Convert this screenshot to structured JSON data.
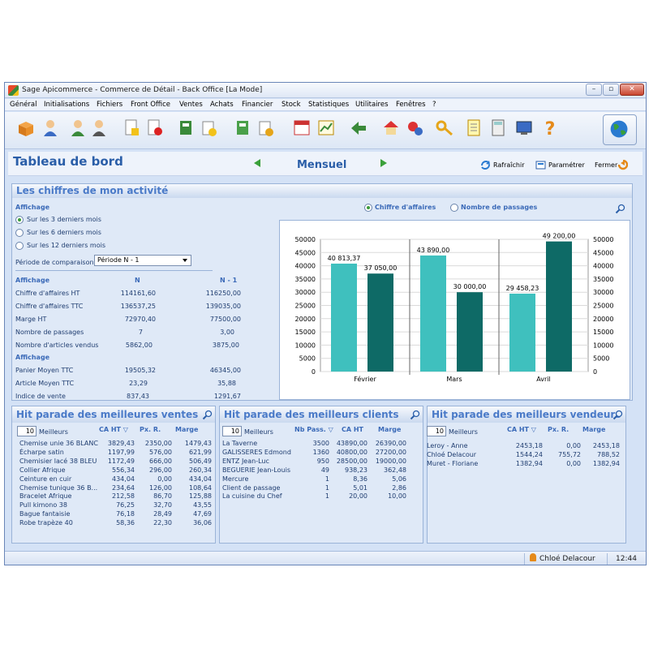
{
  "window": {
    "title": "Sage Apicommerce - Commerce de Détail - Back Office [La Mode]",
    "min_glyph": "–",
    "max_glyph": "▫",
    "close_glyph": "✕"
  },
  "menu": [
    "Général",
    "Initialisations",
    "Fichiers",
    "Front Office",
    "Ventes",
    "Achats",
    "Financier",
    "Stock",
    "Statistiques",
    "Utilitaires",
    "Fenêtres",
    "?"
  ],
  "header": {
    "title": "Tableau de bord",
    "period": "Mensuel",
    "refresh_label": "Rafraîchir",
    "settings_label": "Paramétrer",
    "close_label": "Fermer"
  },
  "activity": {
    "title": "Les chiffres de mon activité",
    "display_label": "Affichage",
    "options": [
      "Sur les 3 derniers mois",
      "Sur les 6 derniers mois",
      "Sur les 12 derniers mois"
    ],
    "comparison_label": "Période de comparaison",
    "comparison_value": "Période N - 1",
    "col_n": "N",
    "col_n1": "N - 1",
    "section1": "Affichage",
    "rows1": [
      {
        "label": "Chiffre d'affaires HT",
        "n": "114161,60",
        "n1": "116250,00"
      },
      {
        "label": "Chiffre d'affaires TTC",
        "n": "136537,25",
        "n1": "139035,00"
      },
      {
        "label": "Marge HT",
        "n": "72970,40",
        "n1": "77500,00"
      },
      {
        "label": "Nombre de passages",
        "n": "7",
        "n1": "3,00"
      },
      {
        "label": "Nombre d'articles vendus",
        "n": "5862,00",
        "n1": "3875,00"
      }
    ],
    "section2": "Affichage",
    "rows2": [
      {
        "label": "Panier Moyen TTC",
        "n": "19505,32",
        "n1": "46345,00"
      },
      {
        "label": "Article Moyen TTC",
        "n": "23,29",
        "n1": "35,88"
      },
      {
        "label": "Indice de vente",
        "n": "837,43",
        "n1": "1291,67"
      }
    ],
    "chart_opt1": "Chiffre d'affaires",
    "chart_opt2": "Nombre de passages"
  },
  "chart_data": {
    "type": "bar",
    "categories": [
      "Février",
      "Mars",
      "Avril"
    ],
    "series": [
      {
        "values": [
          40813.37,
          43890.0,
          29458.23
        ],
        "labels": [
          "40 813,37",
          "43 890,00",
          "29 458,23"
        ],
        "color": "#3fc0be"
      },
      {
        "values": [
          37050.0,
          30000.0,
          49200.0
        ],
        "labels": [
          "37 050,00",
          "30 000,00",
          "49 200,00"
        ],
        "color": "#0e6a66"
      }
    ],
    "ylim": [
      0,
      50000
    ],
    "yticks": [
      "0",
      "5000",
      "10000",
      "15000",
      "20000",
      "25000",
      "30000",
      "35000",
      "40000",
      "45000",
      "50000"
    ],
    "grid": true,
    "dual_axis": true
  },
  "hit_sales": {
    "title": "Hit parade des meilleures ventes",
    "count": "10",
    "count_label": "Meilleurs",
    "cols": [
      "CA HT ▽",
      "Px. R.",
      "Marge"
    ],
    "rows": [
      [
        "Chemise unie 36 BLANC",
        "3829,43",
        "2350,00",
        "1479,43"
      ],
      [
        "Écharpe satin",
        "1197,99",
        "576,00",
        "621,99"
      ],
      [
        "Chemisier lacé 38 BLEU",
        "1172,49",
        "666,00",
        "506,49"
      ],
      [
        "Collier Afrique",
        "556,34",
        "296,00",
        "260,34"
      ],
      [
        "Ceinture en cuir",
        "434,04",
        "0,00",
        "434,04"
      ],
      [
        "Chemise tunique 36 B...",
        "234,64",
        "126,00",
        "108,64"
      ],
      [
        "Bracelet Afrique",
        "212,58",
        "86,70",
        "125,88"
      ],
      [
        "Pull kimono 38",
        "76,25",
        "32,70",
        "43,55"
      ],
      [
        "Bague fantaisie",
        "76,18",
        "28,49",
        "47,69"
      ],
      [
        "Robe trapèze 40",
        "58,36",
        "22,30",
        "36,06"
      ]
    ]
  },
  "hit_clients": {
    "title": "Hit parade des meilleurs clients",
    "count": "10",
    "count_label": "Meilleurs",
    "cols": [
      "Nb Pass. ▽",
      "CA HT",
      "Marge"
    ],
    "rows": [
      [
        "La Taverne",
        "3500",
        "43890,00",
        "26390,00"
      ],
      [
        "GALISSERES Edmond",
        "1360",
        "40800,00",
        "27200,00"
      ],
      [
        "ENTZ Jean-Luc",
        "950",
        "28500,00",
        "19000,00"
      ],
      [
        "BEGUERIE Jean-Louis",
        "49",
        "938,23",
        "362,48"
      ],
      [
        "Mercure",
        "1",
        "8,36",
        "5,06"
      ],
      [
        "Client de passage",
        "1",
        "5,01",
        "2,86"
      ],
      [
        "La cuisine du Chef",
        "1",
        "20,00",
        "10,00"
      ]
    ]
  },
  "hit_sellers": {
    "title": "Hit parade des meilleurs vendeurs",
    "count": "10",
    "count_label": "Meilleurs",
    "cols": [
      "CA HT ▽",
      "Px. R.",
      "Marge"
    ],
    "rows": [
      [
        "Leroy - Anne",
        "2453,18",
        "0,00",
        "2453,18"
      ],
      [
        "Chloé Delacour",
        "1544,24",
        "755,72",
        "788,52"
      ],
      [
        "Muret - Floriane",
        "1382,94",
        "0,00",
        "1382,94"
      ]
    ]
  },
  "status": {
    "user": "Chloé Delacour",
    "time": "12:44"
  },
  "colors": {
    "accent": "#2a5ea8",
    "bar_light": "#3fc0be",
    "bar_dark": "#0e6a66"
  }
}
